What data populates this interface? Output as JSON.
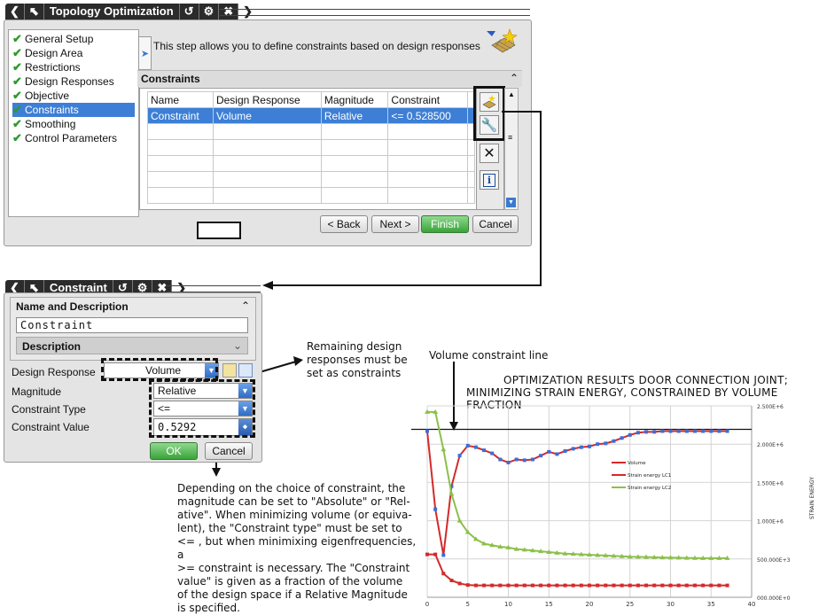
{
  "top_dialog": {
    "title": "Topology Optimization",
    "nav_items": [
      "General Setup",
      "Design Area",
      "Restrictions",
      "Design Responses",
      "Objective",
      "Constraints",
      "Smoothing",
      "Control Parameters"
    ],
    "selected_index": 5,
    "info_text": "This step allows you to define constraints based on design responses",
    "section_title": "Constraints",
    "columns": [
      "Name",
      "Design Response",
      "Magnitude",
      "Constraint"
    ],
    "rows": [
      [
        "Constraint",
        "Volume",
        "Relative",
        "<= 0.528500"
      ]
    ],
    "buttons": {
      "back": "< Back",
      "next": "Next >",
      "finish": "Finish",
      "cancel": "Cancel"
    }
  },
  "constraint_dialog": {
    "title": "Constraint",
    "section_name": "Name and Description",
    "name_value": "Constraint",
    "description_label": "Description",
    "fields": [
      {
        "label": "Design Response",
        "value": "Volume"
      },
      {
        "label": "Magnitude",
        "value": "Relative"
      },
      {
        "label": "Constraint Type",
        "value": "<="
      },
      {
        "label": "Constraint Value",
        "value": "0.5292"
      }
    ],
    "ok": "OK",
    "cancel": "Cancel"
  },
  "annotations": {
    "remaining": [
      "Remaining design",
      "responses must be",
      "set as constraints"
    ],
    "volume_line": "Volume constraint line",
    "explanation": [
      "Depending on the choice of constraint, the",
      "magnitude can be set to \"Absolute\" or \"Rel-",
      "ative\". When minimizing volume (or equiva-",
      "lent), the \"Constraint type\" must be set to",
      "<= , but when minimixing eigenfrequencies, a",
      ">= constraint is necessary. The \"Constraint",
      "value\" is given as a fraction of the volume",
      "of the design space if a Relative Magnitude",
      "is specified."
    ]
  },
  "chart_data": {
    "type": "line",
    "title_line1": "OPTIMIZATION RESULTS DOOR CONNECTION JOINT;",
    "title_line2": "MINIMIZING STRAIN ENERGY, CONSTRAINED BY VOLUME FRACTION",
    "ylabel": "STRAIN ENERGY",
    "xlim": [
      0,
      40
    ],
    "ylim": [
      0,
      2500000
    ],
    "xticks": [
      "0",
      "5",
      "10",
      "15",
      "20",
      "25",
      "30",
      "35",
      "40"
    ],
    "yticks": [
      "000.000E+0",
      "500.000E+3",
      "1.000E+6",
      "1.500E+6",
      "2.000E+6",
      "2.500E+6"
    ],
    "ytick_values": [
      0,
      500000,
      1000000,
      1500000,
      2000000,
      2500000
    ],
    "constraint_line_y": 2170000,
    "legend_position": "center-right",
    "grid": true,
    "series": [
      {
        "name": "Volume",
        "color": "#d42a2a",
        "marker_color": "#3a6fd8",
        "x": [
          0,
          1,
          2,
          3,
          4,
          5,
          6,
          7,
          8,
          9,
          10,
          11,
          12,
          13,
          14,
          15,
          16,
          17,
          18,
          19,
          20,
          21,
          22,
          23,
          24,
          25,
          26,
          27,
          28,
          29,
          30,
          31,
          32,
          33,
          34,
          35,
          36,
          37
        ],
        "y": [
          2170000,
          1150000,
          550000,
          1450000,
          1850000,
          1980000,
          1960000,
          1920000,
          1880000,
          1800000,
          1760000,
          1800000,
          1790000,
          1800000,
          1850000,
          1900000,
          1870000,
          1910000,
          1940000,
          1960000,
          1970000,
          2000000,
          2010000,
          2040000,
          2080000,
          2120000,
          2150000,
          2160000,
          2160000,
          2170000,
          2170000,
          2170000,
          2170000,
          2170000,
          2170000,
          2170000,
          2170000,
          2170000
        ]
      },
      {
        "name": "Strain energy LC1",
        "color": "#d42a2a",
        "marker_color": "#d42a2a",
        "x": [
          0,
          1,
          2,
          3,
          4,
          5,
          6,
          7,
          8,
          9,
          10,
          11,
          12,
          13,
          14,
          15,
          16,
          17,
          18,
          19,
          20,
          21,
          22,
          23,
          24,
          25,
          26,
          27,
          28,
          29,
          30,
          31,
          32,
          33,
          34,
          35,
          36,
          37
        ],
        "y": [
          560000,
          560000,
          310000,
          220000,
          180000,
          160000,
          155000,
          155000,
          155000,
          155000,
          155000,
          155000,
          155000,
          155000,
          155000,
          155000,
          155000,
          155000,
          155000,
          155000,
          155000,
          155000,
          155000,
          155000,
          155000,
          155000,
          155000,
          155000,
          155000,
          155000,
          155000,
          155000,
          155000,
          155000,
          155000,
          155000,
          155000,
          155000
        ]
      },
      {
        "name": "Strain energy LC2",
        "color": "#8cc04a",
        "marker_color": "#8cc04a",
        "x": [
          0,
          1,
          2,
          3,
          4,
          5,
          6,
          7,
          8,
          9,
          10,
          11,
          12,
          13,
          14,
          15,
          16,
          17,
          18,
          19,
          20,
          21,
          22,
          23,
          24,
          25,
          26,
          27,
          28,
          29,
          30,
          31,
          32,
          33,
          34,
          35,
          36,
          37
        ],
        "y": [
          2420000,
          2420000,
          1930000,
          1350000,
          1000000,
          850000,
          760000,
          700000,
          680000,
          660000,
          650000,
          630000,
          620000,
          610000,
          600000,
          590000,
          580000,
          570000,
          565000,
          560000,
          555000,
          550000,
          545000,
          540000,
          535000,
          530000,
          528000,
          525000,
          522000,
          520000,
          518000,
          516000,
          514000,
          512000,
          511000,
          510000,
          510000,
          510000
        ]
      }
    ]
  }
}
